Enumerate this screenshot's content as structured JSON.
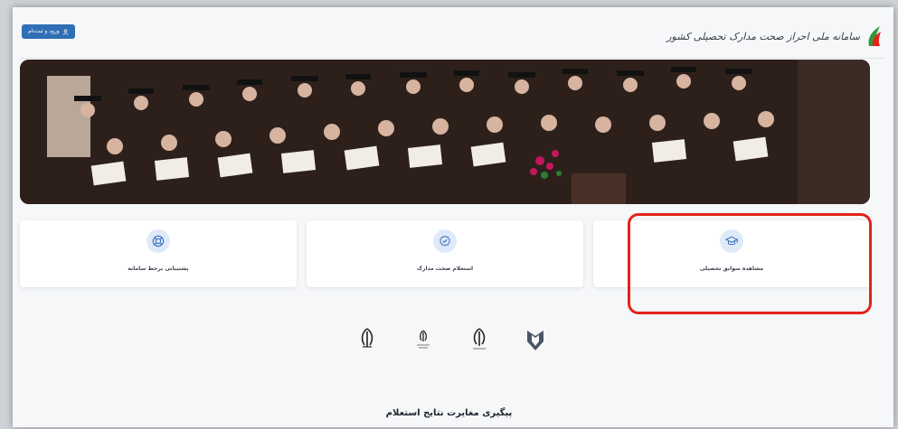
{
  "header": {
    "brand_title": "سامانه ملی احراز صحت مدارک تحصیلی کشور",
    "login_label": "ورود و ثبت‌نام"
  },
  "cards": [
    {
      "label": "پشتیبانی برخط سامانه",
      "icon": "lifebuoy-icon"
    },
    {
      "label": "استعلام صحت مدارک",
      "icon": "check-badge-icon"
    },
    {
      "label": "مشاهده سوابق تحصیلی",
      "icon": "graduation-cap-icon"
    }
  ],
  "footer": {
    "link_label": "پیگیری مغایرت نتایج استعلام"
  },
  "colors": {
    "accent": "#2f6fb5",
    "highlight": "#e2231a"
  }
}
